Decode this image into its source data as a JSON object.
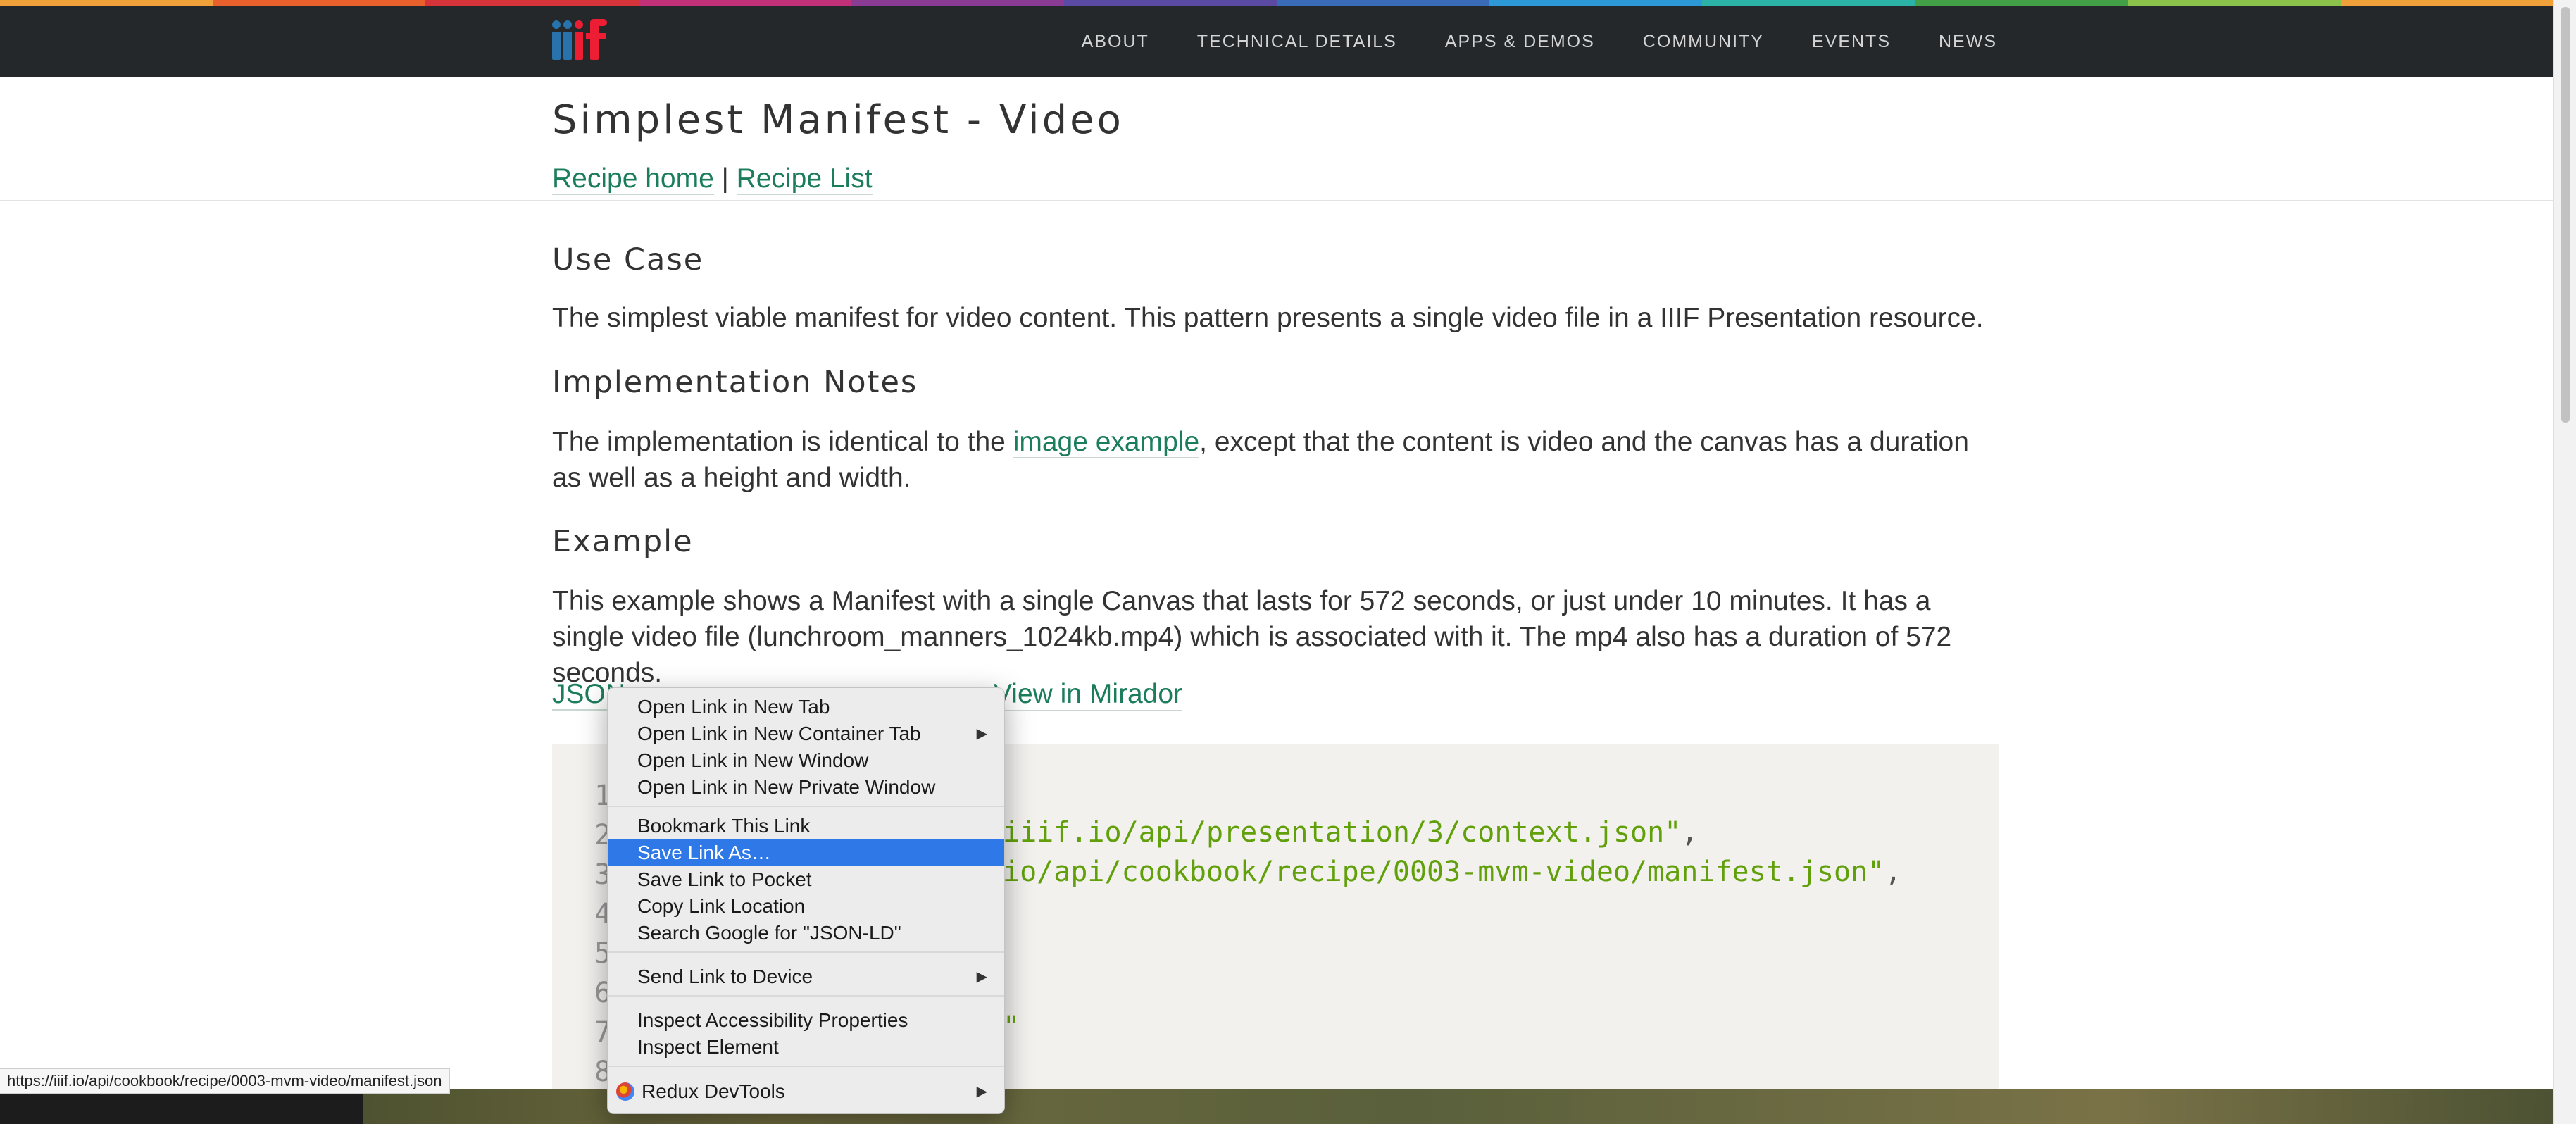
{
  "colors": {
    "rainbow": [
      "#f1a13a",
      "#e8612c",
      "#d6343a",
      "#c2307a",
      "#8a3c95",
      "#5a4aa3",
      "#3a6bb8",
      "#2d98d6",
      "#2bb3a7",
      "#43a047",
      "#8bc34a",
      "#f1a13a"
    ],
    "accent_link": "#1b7d5b",
    "navbar_bg": "#24282b",
    "highlight": "#2e78e8"
  },
  "nav": {
    "logo": "iiif-logo",
    "items": [
      "ABOUT",
      "TECHNICAL DETAILS",
      "APPS & DEMOS",
      "COMMUNITY",
      "EVENTS",
      "NEWS"
    ]
  },
  "page": {
    "title": "Simplest Manifest - Video",
    "recipe_home": "Recipe home",
    "separator": "|",
    "recipe_list": "Recipe List"
  },
  "sections": {
    "use_case": {
      "heading": "Use Case",
      "text": "The simplest viable manifest for video content. This pattern presents a single video file in a IIIF Presentation resource."
    },
    "implementation": {
      "heading": "Implementation Notes",
      "text_before": "The implementation is identical to the ",
      "link": "image example",
      "text_after": ", except that the content is video and the canvas has a duration as well as a height and width."
    },
    "example": {
      "heading": "Example",
      "text": "This example shows a Manifest with a single Canvas that lasts for 572 seconds, or just under 10 minutes. It has a single video file (lunchroom_manners_1024kb.mp4) which is associated with it. The mp4 also has a duration of 572 seconds."
    }
  },
  "links": {
    "jsonld": "JSON",
    "mirador": "View in Mirador"
  },
  "code": {
    "line_numbers": [
      "1",
      "2",
      "3",
      "4",
      "5",
      "6",
      "7",
      "8"
    ],
    "visible_fragments": [
      {
        "text": "iiif.io/api/presentation/3/context.json\"",
        "trail": ","
      },
      {
        "text": "io/api/cookbook/recipe/0003-mvm-video/manifest.json\"",
        "trail": ","
      },
      {
        "text": "\"",
        "trail": ""
      }
    ]
  },
  "status_bar": {
    "url": "https://iiif.io/api/cookbook/recipe/0003-mvm-video/manifest.json"
  },
  "context_menu": {
    "items": [
      {
        "label": "Open Link in New Tab",
        "submenu": false
      },
      {
        "label": "Open Link in New Container Tab",
        "submenu": true
      },
      {
        "label": "Open Link in New Window",
        "submenu": false
      },
      {
        "label": "Open Link in New Private Window",
        "submenu": false
      },
      {
        "label": "Bookmark This Link",
        "submenu": false
      },
      {
        "label": "Save Link As…",
        "submenu": false,
        "highlighted": true
      },
      {
        "label": "Save Link to Pocket",
        "submenu": false
      },
      {
        "label": "Copy Link Location",
        "submenu": false
      },
      {
        "label": "Search Google for \"JSON-LD\"",
        "submenu": false
      },
      {
        "label": "Send Link to Device",
        "submenu": true
      },
      {
        "label": "Inspect Accessibility Properties",
        "submenu": false
      },
      {
        "label": "Inspect Element",
        "submenu": false
      },
      {
        "label": "Redux DevTools",
        "submenu": true,
        "icon": "redux-devtools-icon"
      }
    ],
    "submenu_arrow": "▶"
  }
}
